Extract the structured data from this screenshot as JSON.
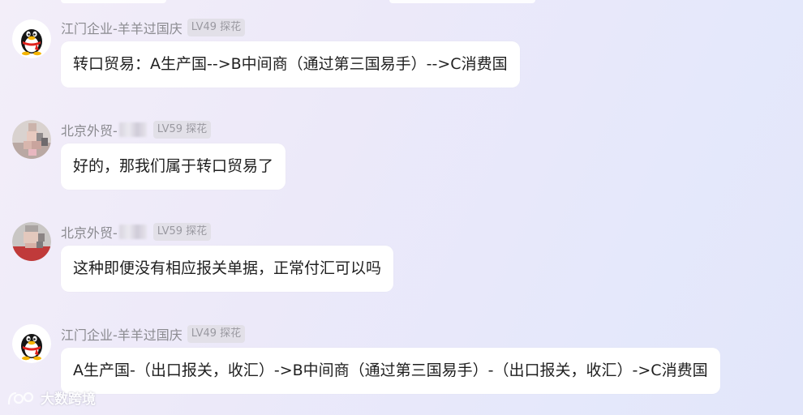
{
  "messages": [
    {
      "avatar": "qq-penguin-avatar",
      "sender": "江门企业-羊羊过国庆",
      "sender_prefix": "",
      "sender_suffix": "",
      "masked": false,
      "level": "LV49 探花",
      "text": "转口贸易：A生产国-->B中间商（通过第三国易手）-->C消费国"
    },
    {
      "avatar": "blurred-photo-avatar",
      "sender": "",
      "sender_prefix": "北京外贸-",
      "sender_suffix": "",
      "masked": true,
      "level": "LV59 探花",
      "text": "好的，那我们属于转口贸易了"
    },
    {
      "avatar": "blurred-photo-avatar",
      "sender": "",
      "sender_prefix": "北京外贸-",
      "sender_suffix": "",
      "masked": true,
      "level": "LV59 探花",
      "text": "这种即便没有相应报关单据，正常付汇可以吗"
    },
    {
      "avatar": "qq-penguin-avatar",
      "sender": "江门企业-羊羊过国庆",
      "sender_prefix": "",
      "sender_suffix": "",
      "masked": false,
      "level": "LV49 探花",
      "text": "A生产国-（出口报关，收汇）->B中间商（通过第三国易手）-（出口报关，收汇）->C消费国"
    }
  ],
  "watermark": {
    "text": "大数跨境",
    "icon": "logo-icon"
  },
  "colors": {
    "bubble": "#ffffff",
    "sender": "#8a8a8f",
    "badge_bg": "#e2e0e8",
    "badge_text": "#9a99a1",
    "message_text": "#1f1f1f"
  }
}
